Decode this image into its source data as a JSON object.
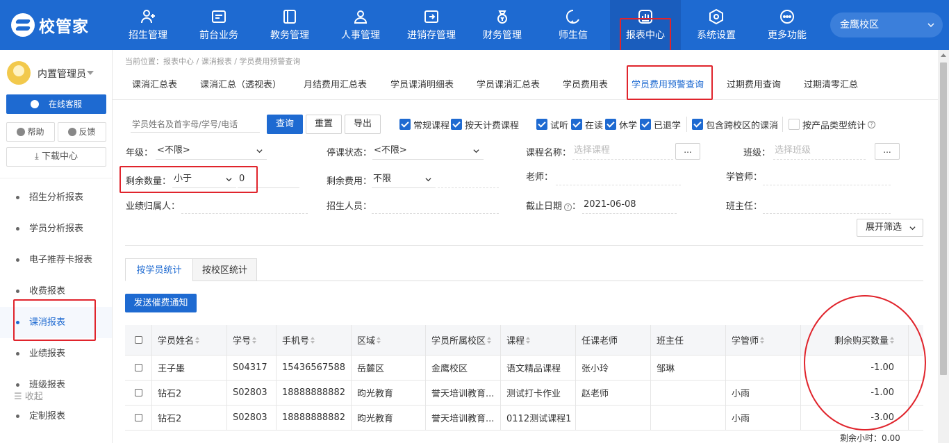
{
  "app": {
    "logo_text": "校管家"
  },
  "nav": [
    {
      "label": "招生管理",
      "icon": "user-add-icon"
    },
    {
      "label": "前台业务",
      "icon": "front-desk-icon"
    },
    {
      "label": "教务管理",
      "icon": "book-icon"
    },
    {
      "label": "人事管理",
      "icon": "person-icon"
    },
    {
      "label": "进销存管理",
      "icon": "inventory-icon"
    },
    {
      "label": "财务管理",
      "icon": "finance-icon"
    },
    {
      "label": "师生信",
      "icon": "message-icon"
    },
    {
      "label": "报表中心",
      "icon": "report-icon",
      "active": true
    },
    {
      "label": "系统设置",
      "icon": "settings-icon"
    },
    {
      "label": "更多功能",
      "icon": "more-icon"
    }
  ],
  "campus_selector": {
    "value": "金鹰校区"
  },
  "sidebar": {
    "user_name": "内置管理员",
    "online_service": "在线客服",
    "help": "帮助",
    "feedback": "反馈",
    "download_center": "下载中心",
    "items": [
      {
        "label": "招生分析报表"
      },
      {
        "label": "学员分析报表"
      },
      {
        "label": "电子推荐卡报表"
      },
      {
        "label": "收费报表"
      },
      {
        "label": "课消报表",
        "active": true
      },
      {
        "label": "业绩报表"
      },
      {
        "label": "班级报表"
      },
      {
        "label": "定制报表"
      }
    ],
    "collapse": "收起"
  },
  "breadcrumb": "当前位置：报表中心 / 课消报表 / 学员费用预警查询",
  "tabs": [
    {
      "label": "课消汇总表"
    },
    {
      "label": "课消汇总（透视表）"
    },
    {
      "label": "月结费用汇总表"
    },
    {
      "label": "学员课消明细表"
    },
    {
      "label": "学员课消汇总表"
    },
    {
      "label": "学员费用表"
    },
    {
      "label": "学员费用预警查询",
      "active": true
    },
    {
      "label": "过期费用查询"
    },
    {
      "label": "过期清零汇总"
    }
  ],
  "toolbar": {
    "search_placeholder": "学员姓名及首字母/学号/电话",
    "query": "查询",
    "reset": "重置",
    "export": "导出",
    "checkboxes": [
      {
        "label": "常规课程",
        "checked": true
      },
      {
        "label": "按天计费课程",
        "checked": true
      },
      {
        "label": "试听",
        "checked": true
      },
      {
        "label": "在读",
        "checked": true
      },
      {
        "label": "休学",
        "checked": true
      },
      {
        "label": "已退学",
        "checked": true
      },
      {
        "label": "包含跨校区的课消",
        "checked": true
      },
      {
        "label": "按产品类型统计",
        "checked": false
      }
    ]
  },
  "filters": {
    "grade_label": "年级：",
    "grade_value": "<不限>",
    "suspend_label": "停课状态：",
    "suspend_value": "<不限>",
    "course_label": "课程名称：",
    "course_placeholder": "选择课程",
    "class_label": "班级：",
    "class_placeholder": "选择班级",
    "dots": "...",
    "remain_qty_label": "剩余数量：",
    "remain_qty_op": "小于",
    "remain_qty_value": "0",
    "remain_fee_label": "剩余费用：",
    "remain_fee_value": "不限",
    "teacher_label": "老师：",
    "manager_label": "学管师：",
    "owner_label": "业绩归属人：",
    "recruiter_label": "招生人员：",
    "deadline_label": "截止日期",
    "deadline_value": "2021-06-08",
    "head_teacher_label": "班主任：",
    "expand": "展开筛选"
  },
  "sub_tabs": [
    {
      "label": "按学员统计",
      "active": true
    },
    {
      "label": "按校区统计"
    }
  ],
  "notify_button": "发送催费通知",
  "table": {
    "headers": [
      "学员姓名",
      "学号",
      "手机号",
      "区域",
      "学员所属校区",
      "课程",
      "任课老师",
      "班主任",
      "学管师",
      "剩余购买数量"
    ],
    "rows": [
      [
        "王子墨",
        "S04317",
        "15436567588",
        "岳麓区",
        "金鹰校区",
        "语文精品课程",
        "张小玲",
        "邹琳",
        "",
        "-1.00"
      ],
      [
        "钻石2",
        "S02803",
        "18888888882",
        "昀光教育",
        "誉天培训教育...",
        "测试打卡作业",
        "赵老师",
        "",
        "小雨",
        "-1.00"
      ],
      [
        "钻石2",
        "S02803",
        "18888888882",
        "昀光教育",
        "誉天培训教育...",
        "0112测试课程1",
        "",
        "",
        "小雨",
        "-3.00"
      ]
    ],
    "summary": "剩余小时：0.00"
  }
}
